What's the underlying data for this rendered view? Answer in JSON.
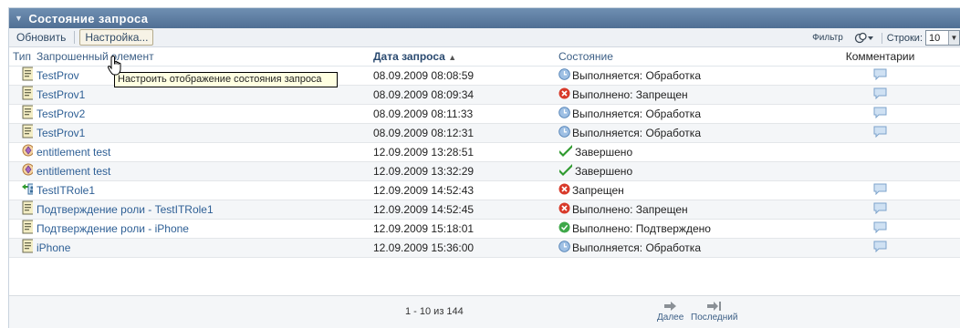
{
  "panel": {
    "title": "Состояние запроса"
  },
  "toolbar": {
    "refresh_label": "Обновить",
    "settings_label": "Настройка...",
    "filter_label": "Фильтр",
    "rows_label": "Строки:",
    "rows_value": "10"
  },
  "tooltip": {
    "text": "Настроить отображение состояния запроса"
  },
  "columns": {
    "type": "Тип",
    "requested_item": "Запрошенный элемент",
    "request_date": "Дата запроса",
    "sort_indicator": "▲",
    "status": "Состояние",
    "comments": "Комментарии"
  },
  "rows": [
    {
      "type_icon": "document-icon",
      "name": "TestProv",
      "date": "08.09.2009 08:08:59",
      "status_icon": "clock-icon",
      "status": "Выполняется: Обработка",
      "has_comment": true
    },
    {
      "type_icon": "document-icon",
      "name": "TestProv1",
      "date": "08.09.2009 08:09:34",
      "status_icon": "error-icon",
      "status": "Выполнено: Запрещен",
      "has_comment": true
    },
    {
      "type_icon": "document-icon",
      "name": "TestProv2",
      "date": "08.09.2009 08:11:33",
      "status_icon": "clock-icon",
      "status": "Выполняется: Обработка",
      "has_comment": true
    },
    {
      "type_icon": "document-icon",
      "name": "TestProv1",
      "date": "08.09.2009 08:12:31",
      "status_icon": "clock-icon",
      "status": "Выполняется: Обработка",
      "has_comment": true
    },
    {
      "type_icon": "entitlement-icon",
      "name": "entitlement test",
      "date": "12.09.2009 13:28:51",
      "status_icon": "checkmark-icon",
      "status": "Завершено",
      "has_comment": false
    },
    {
      "type_icon": "entitlement-icon",
      "name": "entitlement test",
      "date": "12.09.2009 13:32:29",
      "status_icon": "checkmark-icon",
      "status": "Завершено",
      "has_comment": false
    },
    {
      "type_icon": "role-icon",
      "name": "TestITRole1",
      "date": "12.09.2009 14:52:43",
      "status_icon": "error-icon",
      "status": "Запрещен",
      "has_comment": true
    },
    {
      "type_icon": "document-icon",
      "name": "Подтверждение роли - TestITRole1",
      "date": "12.09.2009 14:52:45",
      "status_icon": "error-icon",
      "status": "Выполнено: Запрещен",
      "has_comment": true
    },
    {
      "type_icon": "document-icon",
      "name": "Подтверждение роли - iPhone",
      "date": "12.09.2009 15:18:01",
      "status_icon": "approved-icon",
      "status": "Выполнено: Подтверждено",
      "has_comment": true
    },
    {
      "type_icon": "document-icon",
      "name": "iPhone",
      "date": "12.09.2009 15:36:00",
      "status_icon": "clock-icon",
      "status": "Выполняется: Обработка",
      "has_comment": true
    }
  ],
  "pager": {
    "info": "1 - 10 из 144",
    "next_label": "Далее",
    "last_label": "Последний"
  },
  "colors": {
    "title_bar": "#5c7ca2",
    "link": "#2e5f95",
    "row_alt": "#f4f6f8",
    "error": "#d83a2a",
    "success": "#2e9a2e",
    "clock": "#6b94c7"
  }
}
